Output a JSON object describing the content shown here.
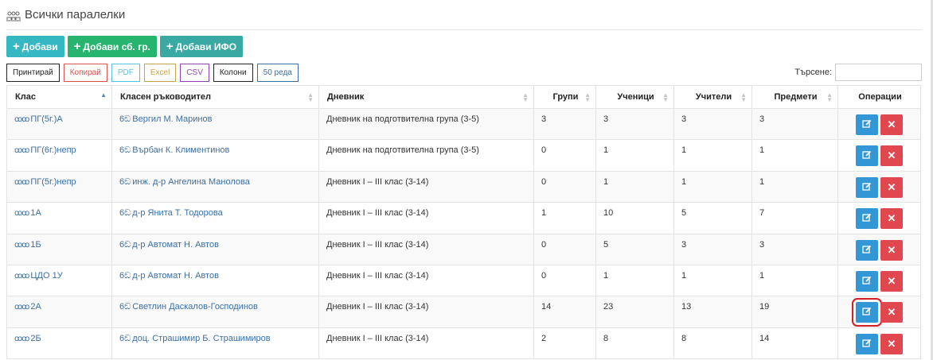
{
  "header": {
    "title": "Всички паралелки"
  },
  "toolbar": {
    "add": "Добави",
    "add_group": "Добави сб. гр.",
    "add_ifo": "Добави ИФО"
  },
  "exports": {
    "print": "Принтирай",
    "copy": "Копирай",
    "pdf": "PDF",
    "excel": "Excel",
    "csv": "CSV",
    "columns": "Колони",
    "rows": "50 реда"
  },
  "colors": {
    "print": "#222222",
    "copy": "#d9534f",
    "pdf": "#5bc0de",
    "excel": "#c8a24a",
    "csv": "#8e44ad",
    "columns": "#222222",
    "rows": "#3a6fa6",
    "highlight": "#d31f26"
  },
  "search": {
    "label": "Търсене:",
    "value": ""
  },
  "table": {
    "columns": [
      "Клас",
      "Класен ръководител",
      "Дневник",
      "Групи",
      "Ученици",
      "Учители",
      "Предмети",
      "Операции"
    ],
    "rows": [
      [
        "ПГ(5г.)А",
        "Вергил М. Маринов",
        "Дневник на подготвителна група (3-5)",
        "3",
        "3",
        "3",
        "3"
      ],
      [
        "ПГ(6г.)непр",
        "Върбан К. Климентинов",
        "Дневник на подготвителна група (3-5)",
        "0",
        "1",
        "1",
        "1"
      ],
      [
        "ПГ(5г.)непр",
        "инж. д-р Ангелина Манолова",
        "Дневник I – III клас (3-14)",
        "0",
        "1",
        "1",
        "1"
      ],
      [
        "1А",
        "д-р Янита Т. Тодорова",
        "Дневник I – III клас (3-14)",
        "1",
        "10",
        "5",
        "7"
      ],
      [
        "1Б",
        "д-р Автомат Н. Автов",
        "Дневник I – III клас (3-14)",
        "0",
        "5",
        "3",
        "3"
      ],
      [
        "ЦДО 1У",
        "д-р Автомат Н. Автов",
        "Дневник I – III клас (3-14)",
        "0",
        "1",
        "1",
        "1"
      ],
      [
        "2А",
        "Светлин Даскалов-Господинов",
        "Дневник I – III клас (3-14)",
        "14",
        "23",
        "13",
        "19"
      ],
      [
        "2Б",
        "доц. Страшимир Б. Страшимиров",
        "Дневник I – III клас (3-14)",
        "2",
        "8",
        "8",
        "14"
      ]
    ],
    "highlighted_row": 6
  },
  "icons": {
    "class": "class-group-icon",
    "teacher": "teacher-icon",
    "edit": "edit-icon",
    "delete": "delete-icon"
  }
}
